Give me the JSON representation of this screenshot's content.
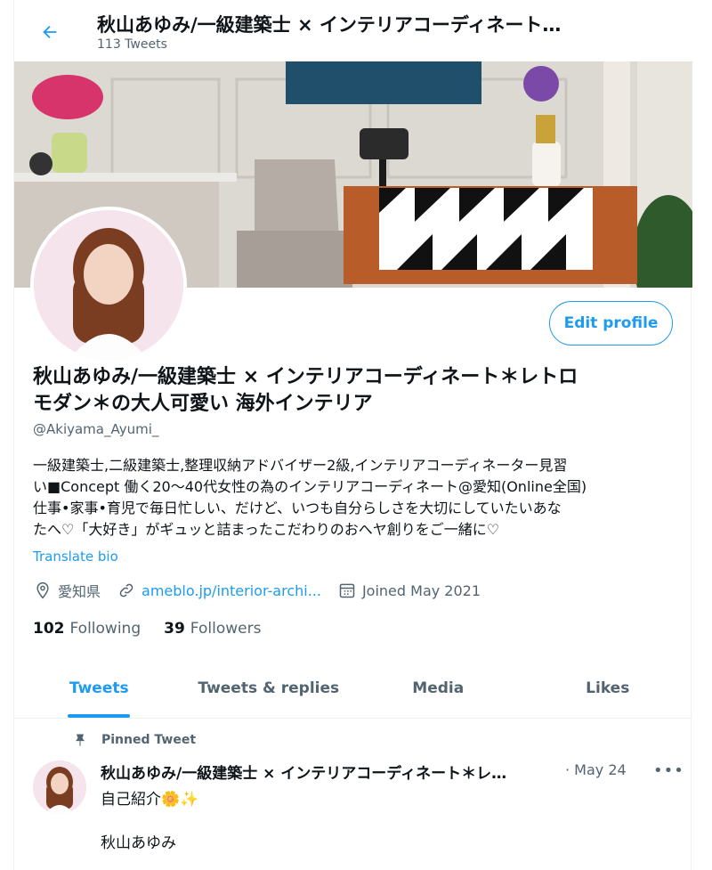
{
  "header": {
    "title": "秋山あゆみ/一級建築士 × インテリアコーディネート…",
    "tweet_count": "113 Tweets"
  },
  "profile": {
    "edit_label": "Edit profile",
    "name_line1": "秋山あゆみ/一級建築士 × インテリアコーディネート＊レトロ",
    "name_line2": "モダン＊の大人可愛い 海外インテリア",
    "handle": "@Akiyama_Ayumi_",
    "bio": [
      "一級建築士,二級建築士,整理収納アドバイザー2級,インテリアコーディネーター見習",
      "い■Concept 働く20〜40代女性の為のインテリアコーディネート@愛知(Online全国)",
      "仕事•家事•育児で毎日忙しい、だけど、いつも自分らしさを大切にしていたいあな",
      "たへ♡「大好き」がギュッと詰まったこだわりのおへヤ創りをご一緒に♡"
    ],
    "translate_label": "Translate bio",
    "location": "愛知県",
    "website": "ameblo.jp/interior-archi...",
    "joined": "Joined May 2021",
    "following_count": "102",
    "following_label": "Following",
    "followers_count": "39",
    "followers_label": "Followers"
  },
  "tabs": [
    {
      "label": "Tweets",
      "active": true
    },
    {
      "label": "Tweets & replies",
      "active": false
    },
    {
      "label": "Media",
      "active": false
    },
    {
      "label": "Likes",
      "active": false
    }
  ],
  "pinned_tweet": {
    "pinned_label": "Pinned Tweet",
    "author": "秋山あゆみ/一級建築士 × インテリアコーディネート＊レ…",
    "date": "· May 24",
    "more": "•••",
    "text_line1": "自己紹介🌼✨",
    "text_line2": "秋山あゆみ"
  },
  "colors": {
    "accent": "#1d9bf0",
    "secondary_text": "#536471",
    "primary_text": "#0f1419"
  },
  "icons": [
    "back-arrow-icon",
    "location-icon",
    "link-icon",
    "calendar-icon",
    "pin-icon",
    "more-icon"
  ]
}
